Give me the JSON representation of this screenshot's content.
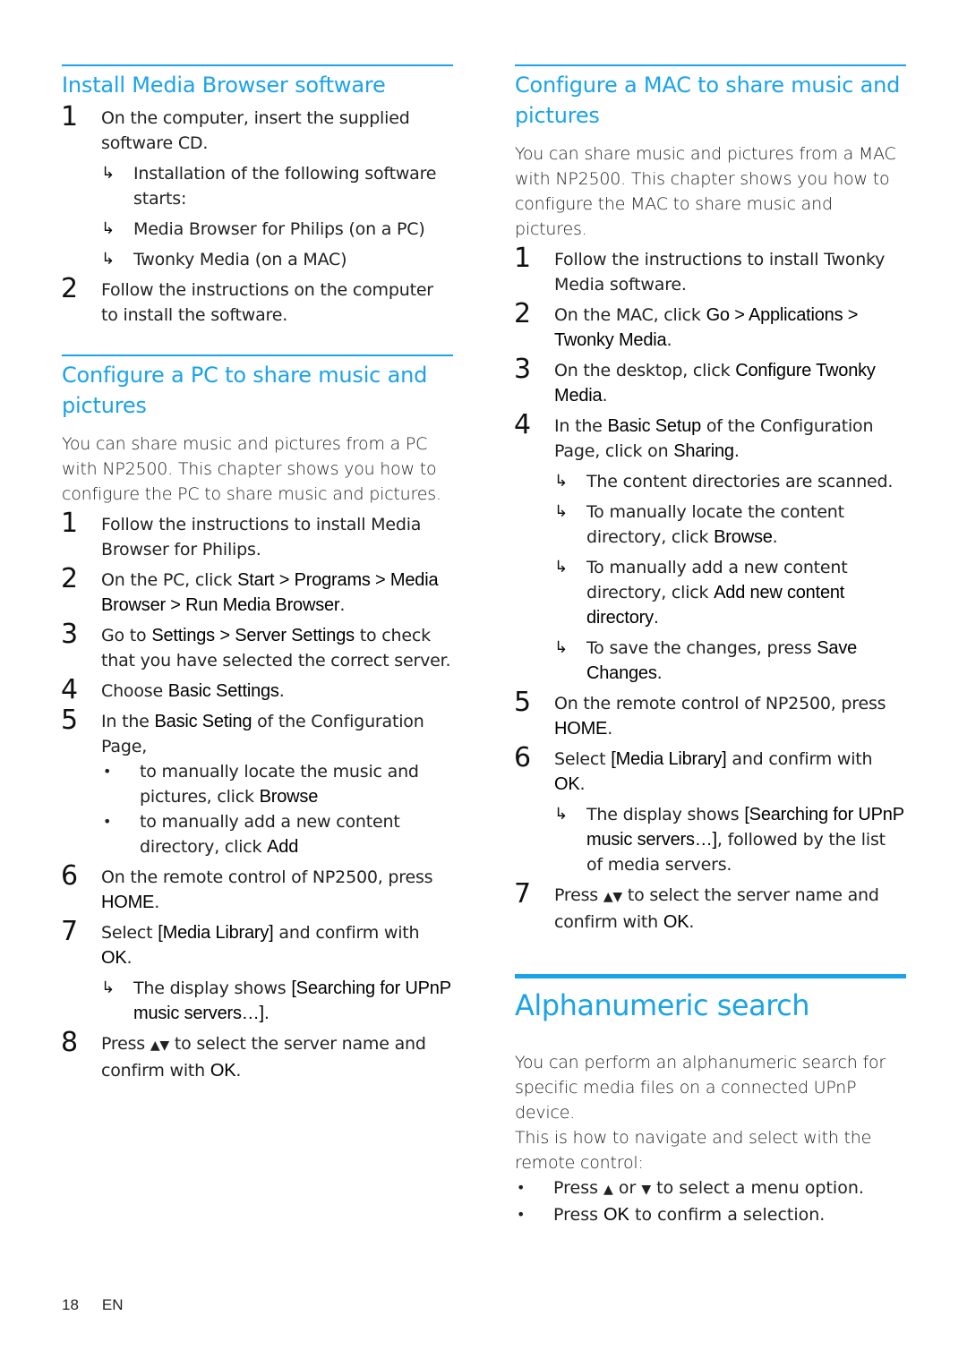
{
  "left": {
    "install": {
      "title": "Install Media Browser software",
      "steps": [
        {
          "num": "1",
          "text": "On the computer, insert the supplied software CD.",
          "subs": [
            "Installation of the following software starts:",
            "Media Browser for Philips (on a PC)",
            "Twonky Media (on a MAC)"
          ]
        },
        {
          "num": "2",
          "text": "Follow the instructions on the computer to install the software."
        }
      ]
    },
    "pc": {
      "title": "Configure a PC to share music and pictures",
      "intro": "You can share music and pictures from a PC with NP2500. This chapter shows you how to configure the PC to share music and pictures.",
      "s1": {
        "num": "1",
        "text": "Follow the instructions to install Media Browser for Philips."
      },
      "s2": {
        "num": "2",
        "a": "On the PC, click ",
        "b1": "Start",
        "sep1": " > ",
        "b2": "Programs",
        "sep2": " > ",
        "b3": "Media Browser",
        "sep3": " > ",
        "b4": "Run Media Browser",
        "end": "."
      },
      "s3": {
        "num": "3",
        "a": "Go to ",
        "b1": "Settings",
        "sep1": " > ",
        "b2": "Server Settings",
        "c": " to check that you have selected the correct server."
      },
      "s4": {
        "num": "4",
        "a": "Choose ",
        "b1": "Basic Settings",
        "end": "."
      },
      "s5": {
        "num": "5",
        "a": "In the ",
        "b1": "Basic Seting",
        "c": " of the Configuration Page,",
        "bul1a": "to manually locate the music and pictures, click ",
        "bul1b": "Browse",
        "bul2a": "to manually add a new content directory, click ",
        "bul2b": "Add"
      },
      "s6": {
        "num": "6",
        "a": "On the remote control of NP2500, press ",
        "b1": "HOME",
        "end": "."
      },
      "s7": {
        "num": "7",
        "a": "Select ",
        "b1": "[Media Library]",
        "c": " and confirm with ",
        "b2": "OK",
        "end": ".",
        "sub_a": "The display shows ",
        "sub_b": "[Searching for UPnP music servers…]",
        "sub_end": "."
      },
      "s8": {
        "num": "8",
        "a": "Press ",
        "arrows": "▲▼",
        "c": " to select the server name and confirm with ",
        "b1": "OK",
        "end": "."
      }
    }
  },
  "right": {
    "mac": {
      "title": "Configure a MAC to share music and pictures",
      "intro": "You can share music and pictures from a MAC with NP2500. This chapter shows you how to configure the MAC to share music and pictures.",
      "s1": {
        "num": "1",
        "text": "Follow the instructions to install Twonky Media software."
      },
      "s2": {
        "num": "2",
        "a": "On the MAC, click ",
        "b1": "Go",
        "sep1": " > ",
        "b2": "Applications",
        "sep2": " > ",
        "b3": "Twonky Media",
        "end": "."
      },
      "s3": {
        "num": "3",
        "a": "On the desktop, click ",
        "b1": "Configure Twonky Media",
        "end": "."
      },
      "s4": {
        "num": "4",
        "a": "In the ",
        "b1": "Basic Setup",
        "c": " of the Configuration Page, click on ",
        "b2": "Sharing",
        "end": ".",
        "sub1": "The content directories are scanned.",
        "sub2a": "To manually locate the content directory, click ",
        "sub2b": "Browse",
        "sub2end": ".",
        "sub3a": "To manually add a new content directory, click ",
        "sub3b": "Add new content directory",
        "sub3end": ".",
        "sub4a": "To save the changes, press ",
        "sub4b": "Save Changes",
        "sub4end": "."
      },
      "s5": {
        "num": "5",
        "a": "On the remote control of NP2500, press ",
        "b1": "HOME",
        "end": "."
      },
      "s6": {
        "num": "6",
        "a": "Select ",
        "b1": "[Media Library]",
        "c": " and confirm with ",
        "b2": "OK",
        "end": ".",
        "sub_a": "The display shows ",
        "sub_b": "[Searching for UPnP music servers…]",
        "sub_end": ", followed by the list of media servers."
      },
      "s7": {
        "num": "7",
        "a": "Press ",
        "arrows": "▲▼",
        "c": " to select the server name and confirm with ",
        "b1": "OK",
        "end": "."
      }
    },
    "alpha": {
      "title": "Alphanumeric search",
      "intro1": "You can perform an alphanumeric search for specific media files on a connected UPnP device.",
      "intro2": "This is how to navigate and select with the remote control:",
      "b1a": "Press ",
      "b1up": "▲",
      "b1or": " or ",
      "b1down": "▼",
      "b1end": " to select a menu option.",
      "b2a": "Press ",
      "b2ok": "OK",
      "b2end": " to confirm a selection."
    }
  },
  "footer": {
    "page": "18",
    "lang": "EN"
  },
  "glyphs": {
    "arrow": "↳",
    "bullet": "•"
  }
}
